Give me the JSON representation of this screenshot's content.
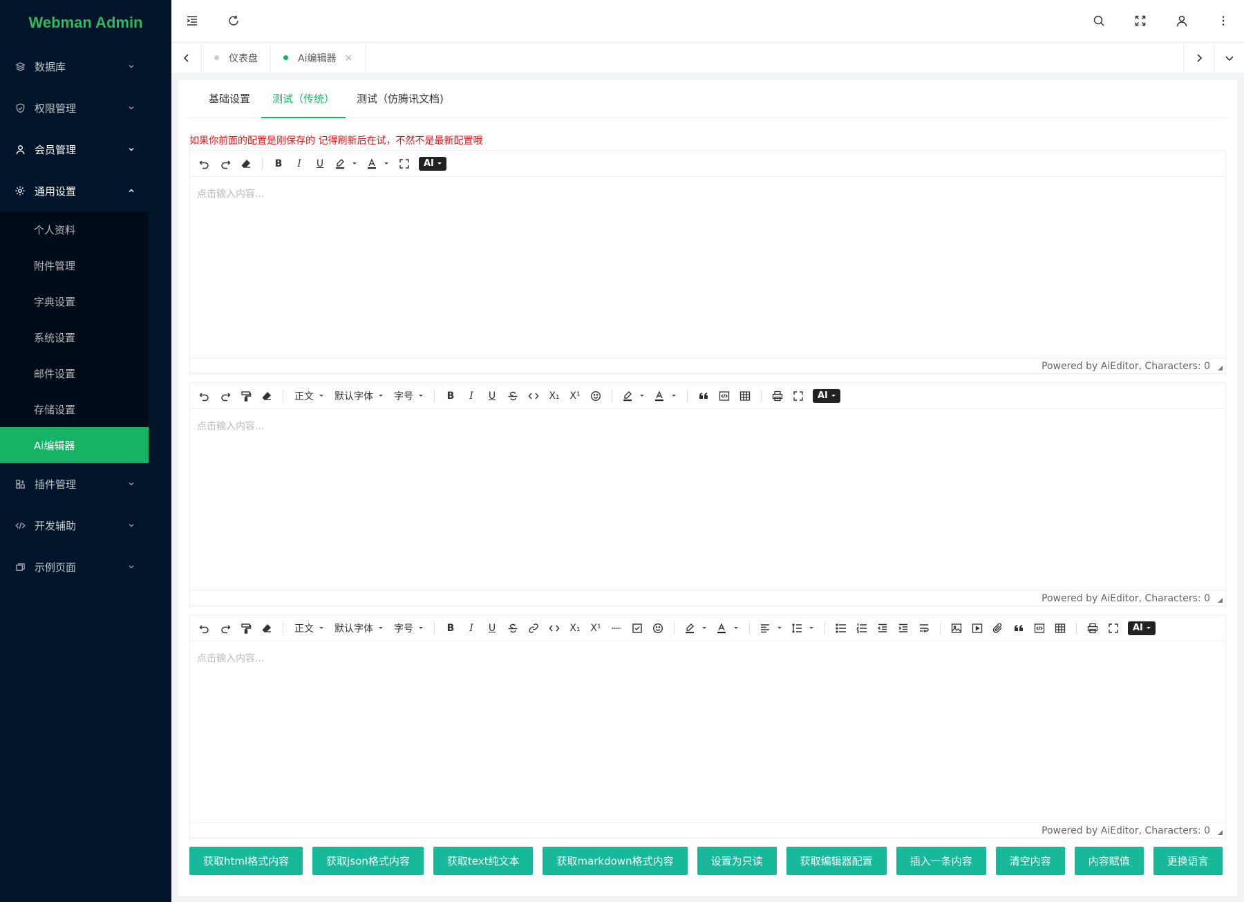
{
  "brand": "Webman Admin",
  "sidebar": {
    "items": [
      {
        "label": "数据库"
      },
      {
        "label": "权限管理"
      },
      {
        "label": "会员管理"
      },
      {
        "label": "通用设置"
      },
      {
        "label": "插件管理"
      },
      {
        "label": "开发辅助"
      },
      {
        "label": "示例页面"
      }
    ],
    "sub": [
      {
        "label": "个人资料"
      },
      {
        "label": "附件管理"
      },
      {
        "label": "字典设置"
      },
      {
        "label": "系统设置"
      },
      {
        "label": "邮件设置"
      },
      {
        "label": "存储设置"
      },
      {
        "label": "Ai编辑器"
      }
    ]
  },
  "pagetabs": [
    {
      "label": "仪表盘"
    },
    {
      "label": "Ai编辑器",
      "close": "×"
    }
  ],
  "content_tabs": [
    {
      "label": "基础设置"
    },
    {
      "label": "测试（传统）"
    },
    {
      "label": "测试（仿腾讯文档)"
    }
  ],
  "warning": "如果你前面的配置是刚保存的 记得刷新后在试，不然不是最新配置哦",
  "editor": {
    "placeholder": "点击输入内容...",
    "powered": "Powered by AiEditor, Characters: 0",
    "para": "正文",
    "font": "默认字体",
    "size": "字号",
    "ai": "AI",
    "glyphs": {
      "bold": "B",
      "italic": "I",
      "underline": "U",
      "sub": "X₁",
      "sup": "X¹"
    }
  },
  "buttons": [
    "获取html格式内容",
    "获取json格式内容",
    "获取text纯文本",
    "获取markdown格式内容",
    "设置为只读",
    "获取编辑器配置",
    "插入一条内容",
    "清空内容",
    "内容赋值",
    "更换语言"
  ],
  "colors": {
    "accent": "#16b364",
    "sidebar": "#001529",
    "button": "#17b99a",
    "warning": "#e4161b"
  }
}
